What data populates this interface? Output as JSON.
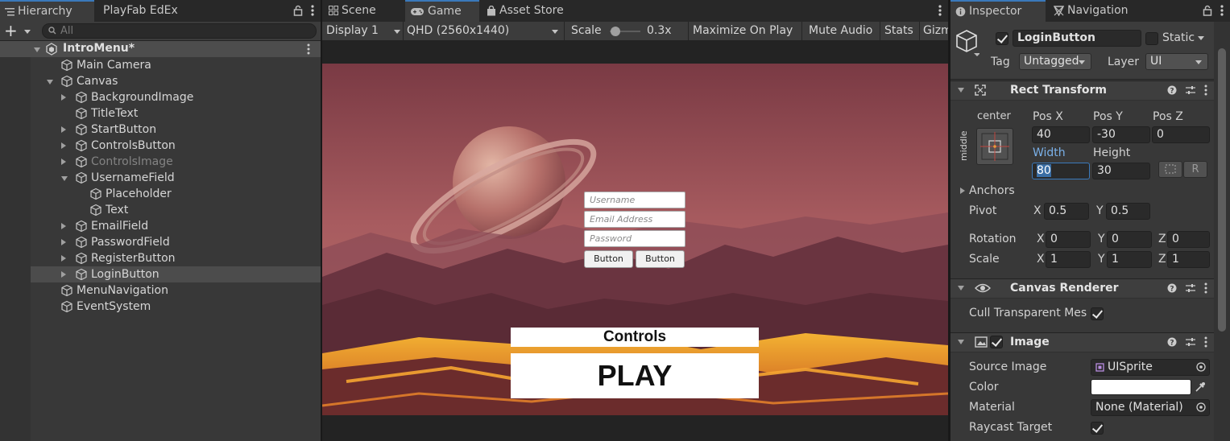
{
  "hierarchy": {
    "tabs": [
      "Hierarchy",
      "PlayFab EdEx"
    ],
    "search_placeholder": "All",
    "scene": "IntroMenu*",
    "items": [
      {
        "label": "Main Camera",
        "depth": 1,
        "expand": "none",
        "dim": false
      },
      {
        "label": "Canvas",
        "depth": 1,
        "expand": "open",
        "dim": false
      },
      {
        "label": "BackgroundImage",
        "depth": 2,
        "expand": "closed",
        "dim": false
      },
      {
        "label": "TitleText",
        "depth": 2,
        "expand": "none",
        "dim": false
      },
      {
        "label": "StartButton",
        "depth": 2,
        "expand": "closed",
        "dim": false
      },
      {
        "label": "ControlsButton",
        "depth": 2,
        "expand": "closed",
        "dim": false
      },
      {
        "label": "ControlsImage",
        "depth": 2,
        "expand": "closed",
        "dim": true
      },
      {
        "label": "UsernameField",
        "depth": 2,
        "expand": "open",
        "dim": false
      },
      {
        "label": "Placeholder",
        "depth": 3,
        "expand": "none",
        "dim": false
      },
      {
        "label": "Text",
        "depth": 3,
        "expand": "none",
        "dim": false
      },
      {
        "label": "EmailField",
        "depth": 2,
        "expand": "closed",
        "dim": false
      },
      {
        "label": "PasswordField",
        "depth": 2,
        "expand": "closed",
        "dim": false
      },
      {
        "label": "RegisterButton",
        "depth": 2,
        "expand": "closed",
        "dim": false
      },
      {
        "label": "LoginButton",
        "depth": 2,
        "expand": "closed",
        "dim": false,
        "selected": true
      },
      {
        "label": "MenuNavigation",
        "depth": 1,
        "expand": "none",
        "dim": false
      },
      {
        "label": "EventSystem",
        "depth": 1,
        "expand": "none",
        "dim": false
      }
    ]
  },
  "game": {
    "tabs": [
      "Scene",
      "Game",
      "Asset Store"
    ],
    "display": "Display 1",
    "resolution": "QHD (2560x1440)",
    "scale_label": "Scale",
    "scale_value": "0.3x",
    "scale_fraction": 0.05,
    "maximize": "Maximize On Play",
    "mute": "Mute Audio",
    "stats": "Stats",
    "gizmos": "Gizmos",
    "ui": {
      "username_placeholder": "Username",
      "email_placeholder": "Email Address",
      "password_placeholder": "Password",
      "button1": "Button",
      "button2": "Button",
      "controls": "Controls",
      "play": "PLAY"
    }
  },
  "inspector": {
    "tabs": [
      "Inspector",
      "Navigation"
    ],
    "object_name": "LoginButton",
    "static_label": "Static",
    "tag_label": "Tag",
    "tag_value": "Untagged",
    "layer_label": "Layer",
    "layer_value": "UI",
    "rect_transform": {
      "title": "Rect Transform",
      "anchor_h": "center",
      "anchor_v": "middle",
      "pos_x_label": "Pos X",
      "pos_x": "40",
      "pos_y_label": "Pos Y",
      "pos_y": "-30",
      "pos_z_label": "Pos Z",
      "pos_z": "0",
      "width_label": "Width",
      "width": "80",
      "height_label": "Height",
      "height": "30",
      "anchors_label": "Anchors",
      "pivot_label": "Pivot",
      "pivot_x": "0.5",
      "pivot_y": "0.5",
      "rotation_label": "Rotation",
      "rot_x": "0",
      "rot_y": "0",
      "rot_z": "0",
      "scale_label": "Scale",
      "scale_x": "1",
      "scale_y": "1",
      "scale_z": "1",
      "x": "X",
      "y": "Y",
      "z": "Z",
      "raw_btn": "R"
    },
    "canvas_renderer": {
      "title": "Canvas Renderer",
      "cull_label": "Cull Transparent Mes"
    },
    "image": {
      "title": "Image",
      "source_label": "Source Image",
      "source_value": "UISprite",
      "color_label": "Color",
      "material_label": "Material",
      "material_value": "None (Material)",
      "raycast_label": "Raycast Target"
    }
  },
  "colors": {
    "accent": "#3a79bb",
    "panel": "#383838",
    "field": "#2a2a2a",
    "width_label": "#7ab0e8"
  }
}
